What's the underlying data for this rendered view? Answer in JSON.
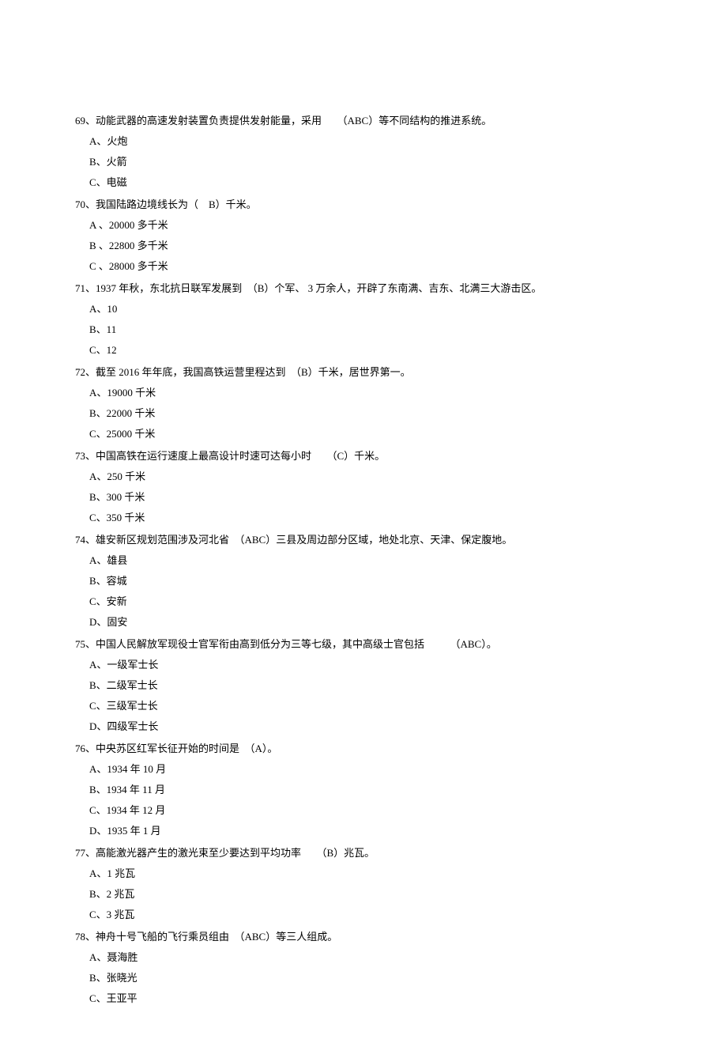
{
  "questions": [
    {
      "num": "69",
      "text": "、动能武器的高速发射装置负责提供发射能量，采用　　（ABC）等不同结构的推进系统。",
      "options": [
        "A、火炮",
        "B、火箭",
        "C、电磁"
      ]
    },
    {
      "num": "70",
      "text": "、我国陆路边境线长为（　B）千米。",
      "options": [
        "A 、20000 多千米",
        "B 、22800 多千米",
        "C 、28000 多千米"
      ]
    },
    {
      "num": "71",
      "text": "、1937 年秋，东北抗日联军发展到　（B）个军、 3 万余人，开辟了东南满、吉东、北满三大游击区。",
      "options": [
        "A、10",
        "B、11",
        "C、12"
      ]
    },
    {
      "num": "72",
      "text": "、截至 2016 年年底，我国高铁运营里程达到　（B）千米，居世界第一。",
      "options": [
        "A、19000 千米",
        "B、22000 千米",
        "C、25000 千米"
      ]
    },
    {
      "num": "73",
      "text": "、中国高铁在运行速度上最高设计时速可达每小时　　（C）千米。",
      "options": [
        "A、250 千米",
        "B、300 千米",
        "C、350 千米"
      ]
    },
    {
      "num": "74",
      "text": "、雄安新区规划范围涉及河北省　（ABC）三县及周边部分区域，地处北京、天津、保定腹地。",
      "options": [
        "A、雄县",
        "B、容城",
        "C、安新",
        "D、固安"
      ]
    },
    {
      "num": "75",
      "text": "、中国人民解放军现役士官军衔由高到低分为三等七级，其中高级士官包括　　　（ABC）。",
      "options": [
        "A、一级军士长",
        "B、二级军士长",
        "C、三级军士长",
        "D、四级军士长"
      ]
    },
    {
      "num": "76",
      "text": "、中央苏区红军长征开始的时间是　（A）。",
      "options": [
        "A、1934 年 10 月",
        "B、1934 年 11 月",
        "C、1934 年 12 月",
        "D、1935 年 1 月"
      ]
    },
    {
      "num": "77",
      "text": "、高能激光器产生的激光束至少要达到平均功率　　（B）兆瓦。",
      "options": [
        "A、1 兆瓦",
        "B、2 兆瓦",
        "C、3 兆瓦"
      ]
    },
    {
      "num": "78",
      "text": "、神舟十号飞船的飞行乘员组由　（ABC）等三人组成。",
      "options": [
        "A、聂海胜",
        "B、张晓光",
        "C、王亚平"
      ]
    }
  ]
}
